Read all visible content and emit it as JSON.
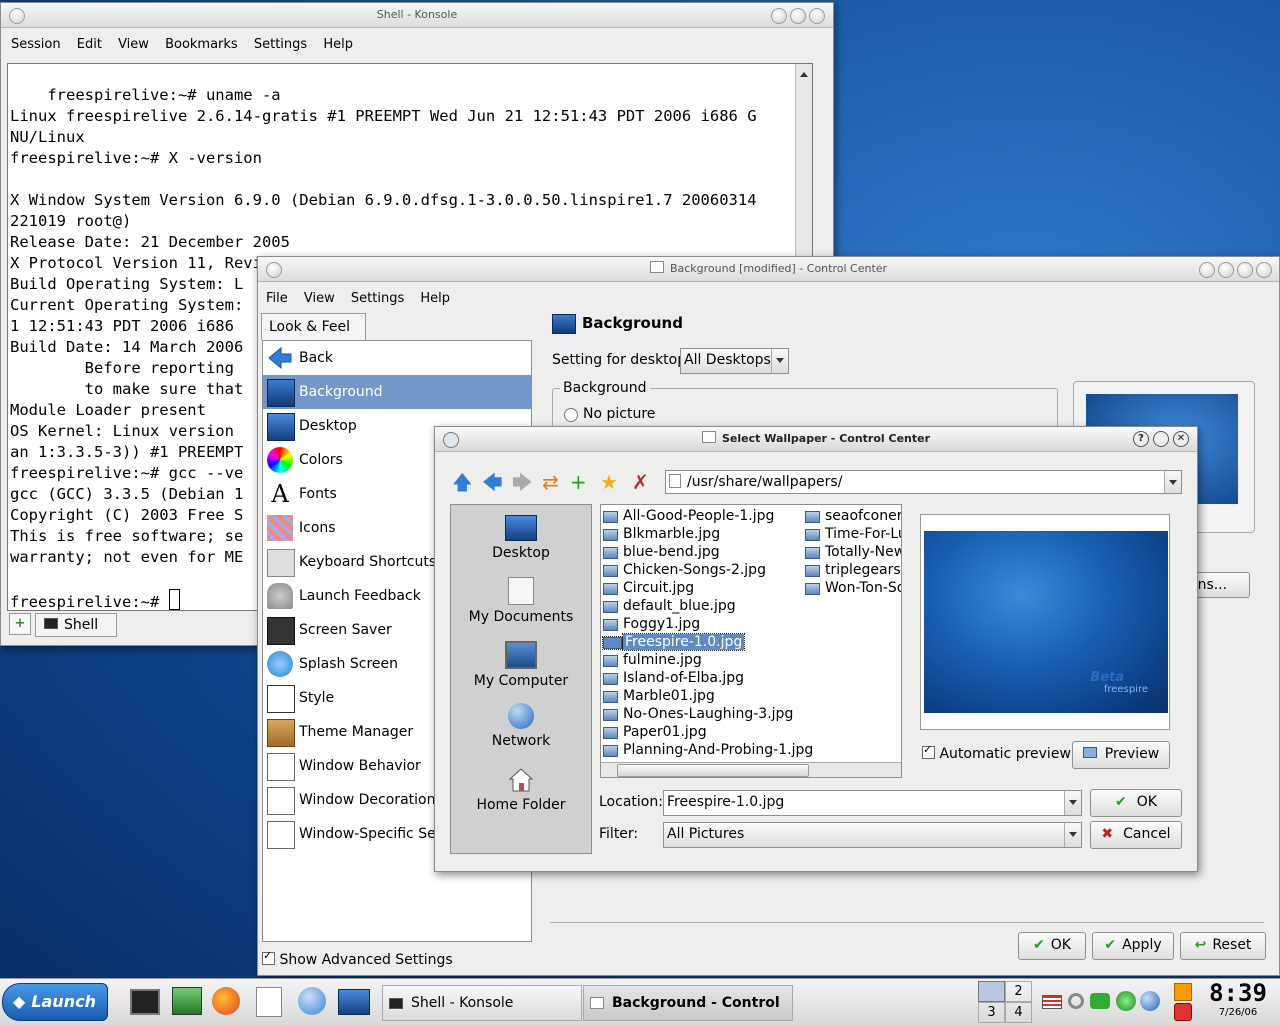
{
  "konsole": {
    "title": "Shell - Konsole",
    "menu": [
      "Session",
      "Edit",
      "View",
      "Bookmarks",
      "Settings",
      "Help"
    ],
    "terminal_text": "freespirelive:~# uname -a\nLinux freespirelive 2.6.14-gratis #1 PREEMPT Wed Jun 21 12:51:43 PDT 2006 i686 G\nNU/Linux\nfreespirelive:~# X -version\n\nX Window System Version 6.9.0 (Debian 6.9.0.dfsg.1-3.0.0.50.linspire1.7 20060314\n221019 root@)\nRelease Date: 21 December 2005\nX Protocol Version 11, Revision 0, Release 6.9\nBuild Operating System: L\nCurrent Operating System:\n1 12:51:43 PDT 2006 i686\nBuild Date: 14 March 2006\n        Before reporting\n        to make sure that\nModule Loader present\nOS Kernel: Linux version\nan 1:3.3.5-3)) #1 PREEMPT\nfreespirelive:~# gcc --ve\ngcc (GCC) 3.3.5 (Debian 1\nCopyright (C) 2003 Free S\nThis is free software; se\nwarranty; not even for ME\n\nfreespirelive:~# ",
    "tab_label": "Shell"
  },
  "control_center": {
    "title": "Background [modified] - Control Center",
    "menu": [
      "File",
      "View",
      "Settings",
      "Help"
    ],
    "tab_label": "Look & Feel",
    "nav_items": [
      "Back",
      "Background",
      "Desktop",
      "Colors",
      "Fonts",
      "Icons",
      "Keyboard Shortcuts",
      "Launch Feedback",
      "Screen Saver",
      "Splash Screen",
      "Style",
      "Theme Manager",
      "Window Behavior",
      "Window Decorations",
      "Window-Specific Setti"
    ],
    "selected_index": 1,
    "page_title": "Background",
    "setting_label": "Setting for desktop:",
    "setting_value": "All Desktops",
    "group_title": "Background",
    "no_picture_label": "No picture",
    "options_button": "ons...",
    "show_advanced": "Show Advanced Settings",
    "ok": "OK",
    "apply": "Apply",
    "reset": "Reset"
  },
  "dialog": {
    "title": "Select Wallpaper - Control Center",
    "path": "/usr/share/wallpapers/",
    "places": [
      "Desktop",
      "My Documents",
      "My Computer",
      "Network",
      "Home Folder"
    ],
    "files_col1": [
      "All-Good-People-1.jpg",
      "Blkmarble.jpg",
      "blue-bend.jpg",
      "Chicken-Songs-2.jpg",
      "Circuit.jpg",
      "default_blue.jpg",
      "Foggy1.jpg",
      "Freespire-1.0.jpg",
      "fulmine.jpg",
      "Island-of-Elba.jpg",
      "Marble01.jpg",
      "No-Ones-Laughing-3.jpg",
      "Paper01.jpg",
      "Planning-And-Probing-1.jpg"
    ],
    "files_col2": [
      "seaofconerd",
      "Time-For-Lu",
      "Totally-New",
      "triplegears.j",
      "Won-Ton-So"
    ],
    "selected_file": "Freespire-1.0.jpg",
    "automatic_preview": "Automatic preview",
    "preview_button": "Preview",
    "location_label": "Location:",
    "location_value": "Freespire-1.0.jpg",
    "filter_label": "Filter:",
    "filter_value": "All Pictures",
    "ok": "OK",
    "cancel": "Cancel",
    "preview_text_1": "Beta",
    "preview_text_2": "freespire"
  },
  "taskbar": {
    "launch": "Launch",
    "task1": "Shell - Konsole",
    "task2": "Background - Control",
    "desktops": [
      "2",
      "3",
      "4"
    ],
    "time": "8:39",
    "date": "7/26/06"
  }
}
